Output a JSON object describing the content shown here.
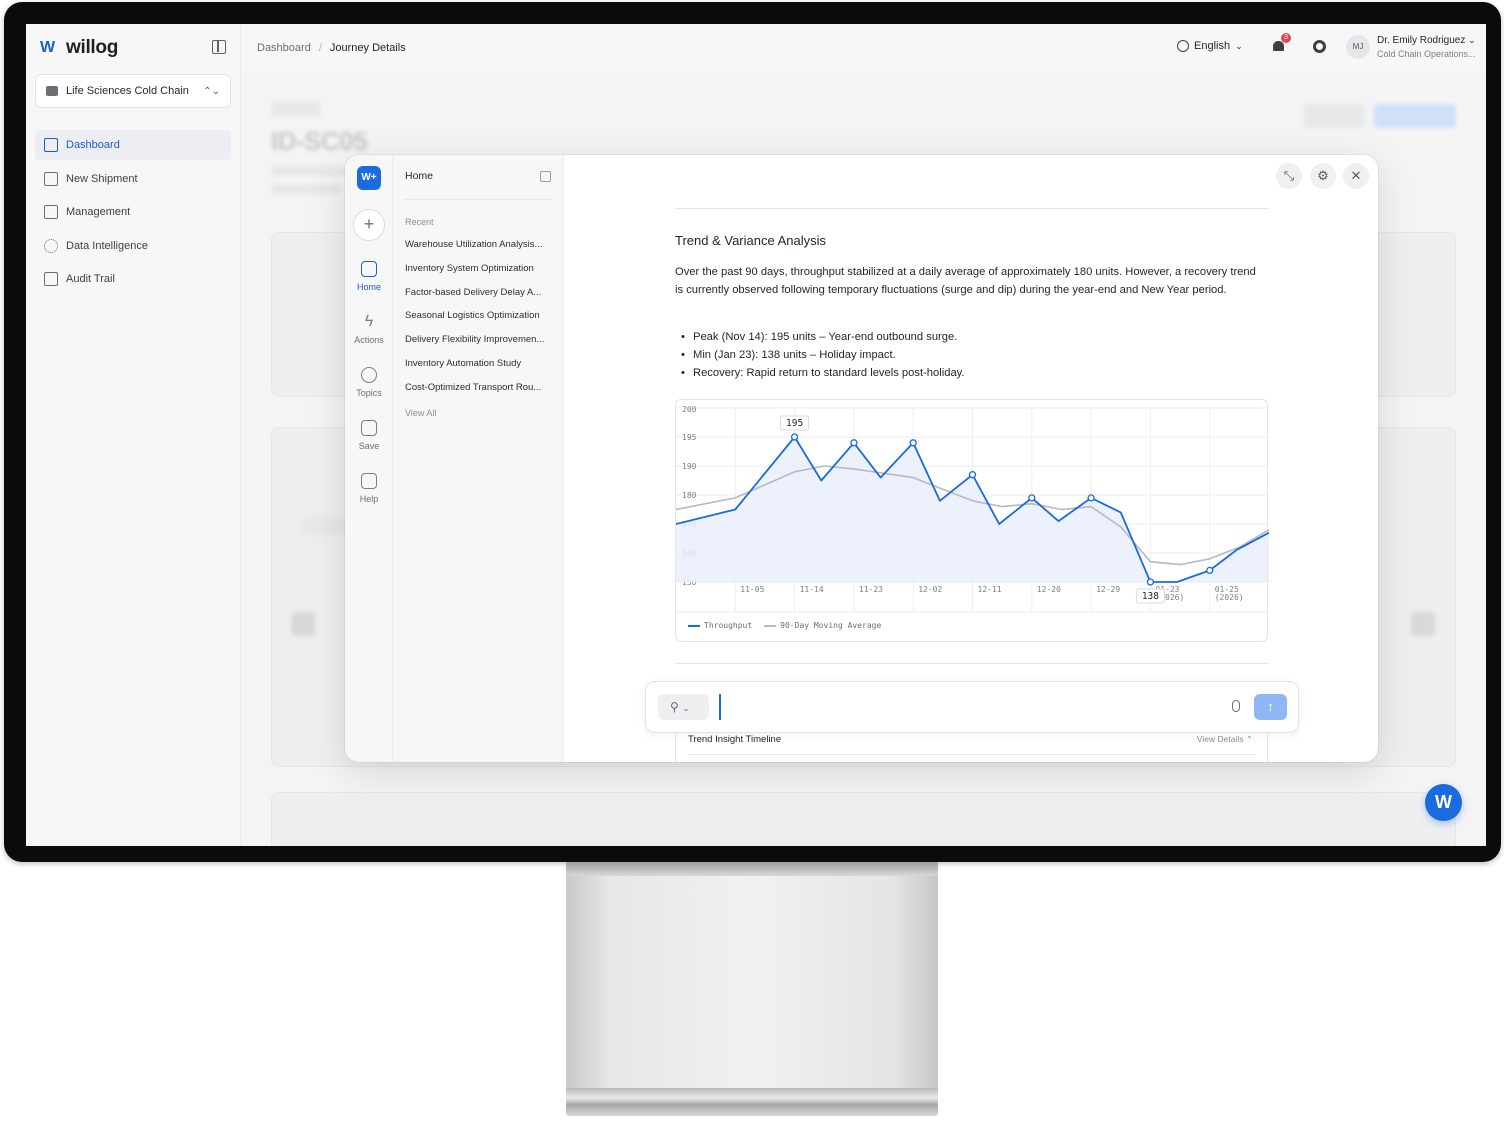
{
  "app": {
    "logo_text": "willog",
    "org_selector": "Life Sciences Cold Chain",
    "nav": [
      {
        "label": "Dashboard",
        "icon": "dashboard-icon",
        "active": true
      },
      {
        "label": "New Shipment",
        "icon": "new-shipment-icon",
        "active": false
      },
      {
        "label": "Management",
        "icon": "management-icon",
        "active": false
      },
      {
        "label": "Data Intelligence",
        "icon": "data-intelligence-icon",
        "active": false
      },
      {
        "label": "Audit Trail",
        "icon": "audit-trail-icon",
        "active": false
      }
    ]
  },
  "topbar": {
    "breadcrumb": [
      "Dashboard",
      "Journey Details"
    ],
    "language": "English",
    "notification_count": "3",
    "avatar_initials": "MJ",
    "user_name": "Dr. Emily Rodriguez",
    "user_role": "Cold Chain Operations..."
  },
  "background_page": {
    "title": "ID-SC05"
  },
  "assistant": {
    "rail": [
      {
        "label": "Home",
        "icon": "home-icon",
        "active": true
      },
      {
        "label": "Actions",
        "icon": "bolt-icon",
        "active": false
      },
      {
        "label": "Topics",
        "icon": "compass-icon",
        "active": false
      },
      {
        "label": "Save",
        "icon": "inbox-icon",
        "active": false
      },
      {
        "label": "Help",
        "icon": "book-icon",
        "active": false
      }
    ],
    "history": {
      "title": "Home",
      "recent_label": "Recent",
      "items": [
        "Warehouse Utilization Analysis...",
        "Inventory System Optimization",
        "Factor-based Delivery Delay A...",
        "Seasonal Logistics Optimization",
        "Delivery Flexibility Improvemen...",
        "Inventory Automation Study",
        "Cost-Optimized Transport Rou..."
      ],
      "view_all": "View All"
    },
    "message": {
      "heading": "Trend & Variance Analysis",
      "paragraph": "Over the past 90 days, throughput stabilized at a daily average of approximately 180 units. However, a recovery trend is currently observed following temporary fluctuations (surge and dip) during the year-end and New Year period.",
      "bullets": [
        "Peak (Nov 14): 195 units – Year-end outbound surge.",
        "Min (Jan 23): 138 units – Holiday impact.",
        "Recovery: Rapid return to standard levels post-holiday."
      ]
    },
    "timeline": {
      "title": "Trend Insight Timeline",
      "view_details": "View Details"
    },
    "composer": {
      "placeholder": ""
    }
  },
  "colors": {
    "accent": "#1a6ae0",
    "throughput": "#1a6ae0",
    "moving_average": "#b7b9be"
  },
  "chart_data": {
    "type": "line",
    "title": "",
    "xlabel": "",
    "ylabel": "",
    "ylim": [
      150,
      200
    ],
    "y_ticks": [
      200,
      195,
      190,
      180,
      170,
      160,
      150
    ],
    "x_ticks": [
      "11-05",
      "11-14",
      "11-23",
      "12-02",
      "12-11",
      "12-20",
      "12-29",
      "01-23\n(2026)",
      "01-25\n(2026)"
    ],
    "series": [
      {
        "name": "Throughput",
        "x": [
          0,
          1,
          2,
          2.45,
          3,
          3.45,
          4,
          4.45,
          5,
          5.45,
          6,
          6.45,
          7,
          7.5,
          8,
          8.45,
          9,
          9.45,
          10
        ],
        "values": [
          170,
          175,
          195,
          185,
          194,
          186,
          194,
          178,
          187,
          170,
          179,
          171,
          179,
          174,
          138,
          146,
          154,
          161,
          167
        ],
        "marked": [
          2,
          4,
          6,
          8,
          10,
          12,
          14,
          16
        ],
        "labels": [
          {
            "index": 2,
            "text": "195"
          },
          {
            "index": 14,
            "text": "138"
          }
        ]
      },
      {
        "name": "90-Day Moving Average",
        "x": [
          0,
          1,
          2,
          2.5,
          3,
          4,
          4.5,
          5,
          5.5,
          6,
          6.5,
          7,
          7.5,
          8,
          8.5,
          9,
          9.5,
          10
        ],
        "values": [
          175,
          179,
          188,
          190,
          189,
          186,
          182,
          178,
          176,
          177,
          175,
          176,
          169,
          157,
          156,
          158,
          162,
          168
        ]
      }
    ],
    "legend": "bottom-left",
    "grid": true
  }
}
